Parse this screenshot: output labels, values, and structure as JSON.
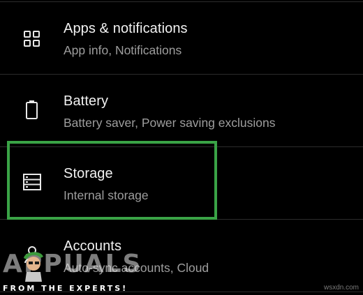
{
  "settings": {
    "items": [
      {
        "title": "Apps & notifications",
        "subtitle": "App info, Notifications",
        "icon": "apps-grid-icon"
      },
      {
        "title": "Battery",
        "subtitle": "Battery saver, Power saving exclusions",
        "icon": "battery-icon"
      },
      {
        "title": "Storage",
        "subtitle": "Internal storage",
        "icon": "storage-icon"
      },
      {
        "title": "Accounts",
        "subtitle": "Auto-sync accounts, Cloud",
        "icon": "account-icon"
      }
    ]
  },
  "highlight": {
    "color": "#3aa346",
    "target": "Storage"
  },
  "watermark": {
    "logo": "APPUALS",
    "tagline": "FROM THE EXPERTS!",
    "site": "wsxdn.com"
  },
  "colors": {
    "background": "#000000",
    "title": "#f2f2f2",
    "subtitle": "#9e9e9e",
    "divider": "#2c2c2c"
  }
}
